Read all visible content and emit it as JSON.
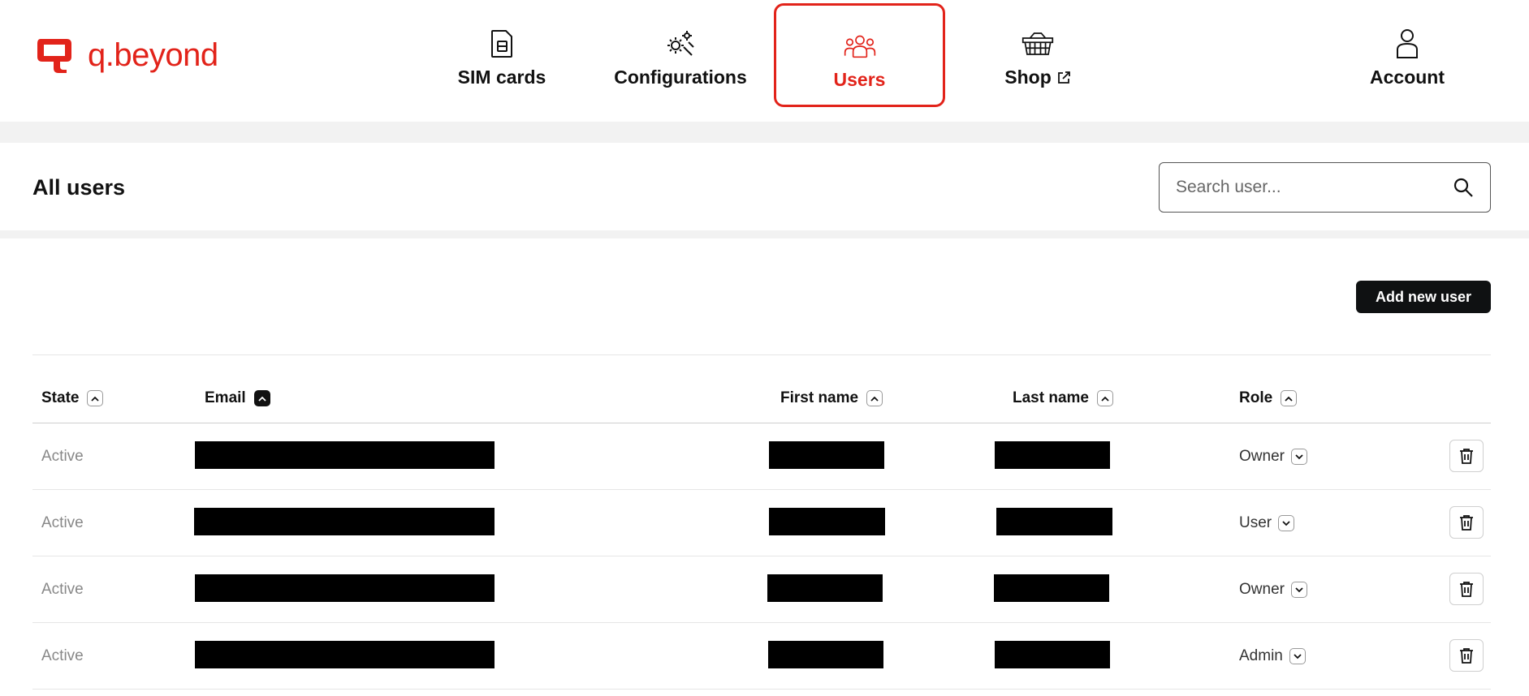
{
  "brand": {
    "name": "q.beyond",
    "accent": "#e2231a"
  },
  "nav": {
    "sim_cards": "SIM cards",
    "configurations": "Configurations",
    "users": "Users",
    "shop": "Shop",
    "account": "Account",
    "active_item": "users"
  },
  "page": {
    "title": "All users"
  },
  "search": {
    "placeholder": "Search user...",
    "value": ""
  },
  "actions": {
    "add_user": "Add new user"
  },
  "table": {
    "columns": {
      "state": "State",
      "email": "Email",
      "first_name": "First name",
      "last_name": "Last name",
      "role": "Role"
    },
    "sorted_column": "email",
    "rows": [
      {
        "state": "Active",
        "role": "Owner"
      },
      {
        "state": "Active",
        "role": "User"
      },
      {
        "state": "Active",
        "role": "Owner"
      },
      {
        "state": "Active",
        "role": "Admin"
      }
    ]
  }
}
